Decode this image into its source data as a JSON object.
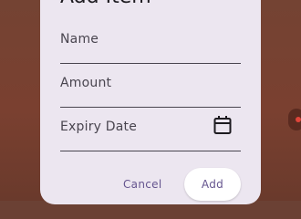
{
  "dialog": {
    "title": "Add Item",
    "fields": [
      {
        "label": "Name"
      },
      {
        "label": "Amount"
      },
      {
        "label": "Expiry Date",
        "icon": "calendar-icon"
      }
    ],
    "actions": {
      "cancel_label": "Cancel",
      "add_label": "Add"
    }
  },
  "colors": {
    "backdrop": "#744333",
    "dialog_surface": "#ece6f0",
    "accent": "#65558f",
    "divider": "#49454f"
  }
}
